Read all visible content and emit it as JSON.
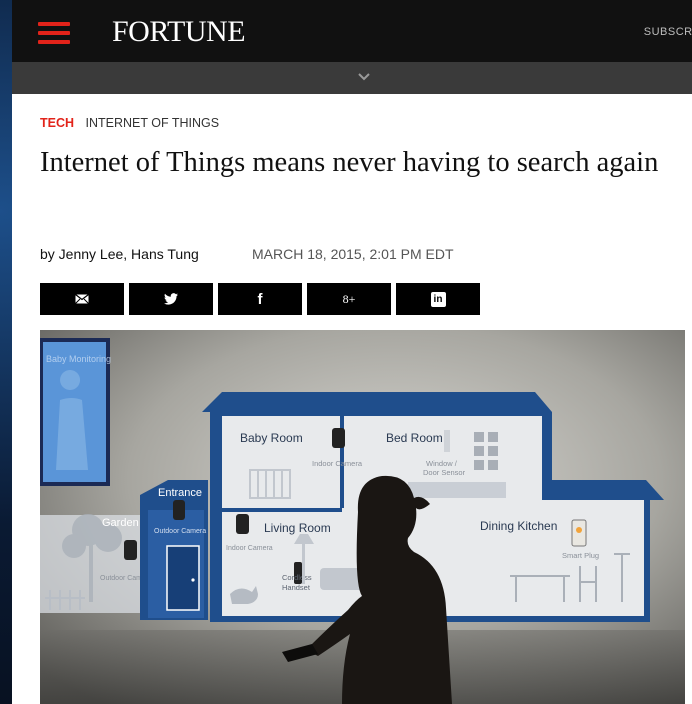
{
  "header": {
    "logo": "FORTUNE",
    "subscribe_label": "SUBSCRIB",
    "accent_color": "#e2231a",
    "icons": {
      "menu": "hamburger-icon",
      "expand": "chevron-down-icon"
    }
  },
  "article": {
    "kicker_primary": "TECH",
    "kicker_secondary": "INTERNET OF THINGS",
    "headline": "Internet of Things means never having to search again",
    "byline": "by Jenny Lee, Hans Tung",
    "date": "MARCH 18, 2015, 2:01 PM EDT"
  },
  "share": [
    {
      "icon": "email-icon",
      "glyph": "✉"
    },
    {
      "icon": "twitter-icon",
      "glyph": ""
    },
    {
      "icon": "facebook-icon",
      "glyph": "f"
    },
    {
      "icon": "google-plus-icon",
      "glyph": "8+"
    },
    {
      "icon": "linkedin-icon",
      "glyph": "in"
    }
  ],
  "hero": {
    "monitor_text": "Baby Monitoring",
    "rooms": {
      "baby_room": "Baby Room",
      "bed_room": "Bed Room",
      "entrance": "Entrance",
      "garden": "Garden",
      "living_room": "Living Room",
      "dining_kitchen": "Dining Kitchen"
    },
    "devices": {
      "indoor_camera": "Indoor Camera",
      "indoor_camera_2": "Indoor Camera",
      "window_sensor_1": "Window /",
      "window_sensor_2": "Door Sensor",
      "outdoor_camera": "Outdoor Camera",
      "outdoor_camera_2": "Outdoor Camera",
      "cordless_1": "Cordless",
      "cordless_2": "Handset",
      "smart_plug": "Smart Plug"
    }
  }
}
